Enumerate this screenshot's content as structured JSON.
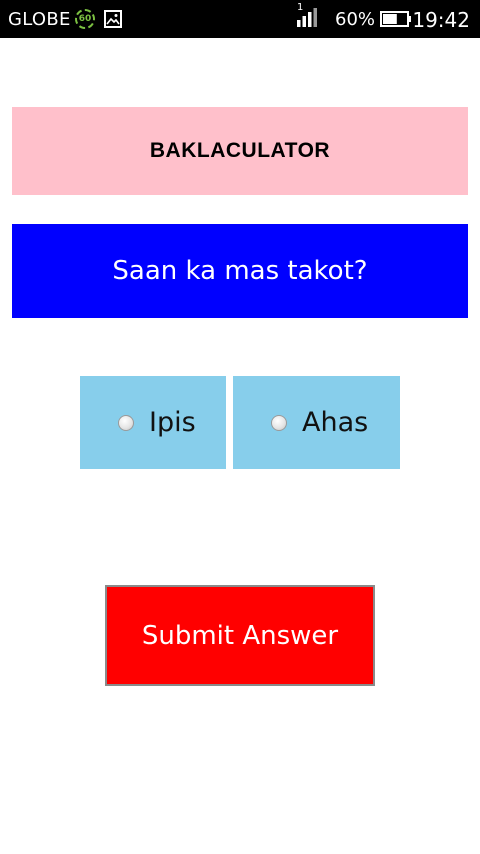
{
  "status_bar": {
    "carrier": "GLOBE",
    "data_badge": "60",
    "signal_slot": "1",
    "battery_percent": "60%",
    "battery_level": 0.6,
    "time": "19:42",
    "icons": [
      "data-indicator-icon",
      "image-icon",
      "signal-icon",
      "battery-icon"
    ]
  },
  "app": {
    "title": "BAKLACULATOR",
    "question": "Saan ka mas takot?",
    "options": [
      {
        "label": "Ipis",
        "selected": false
      },
      {
        "label": "Ahas",
        "selected": false
      }
    ],
    "submit_label": "Submit Answer"
  },
  "colors": {
    "title_bg": "#ffc0cb",
    "question_bg": "#0000ff",
    "option_bg": "#87ceeb",
    "submit_bg": "#ff0000",
    "status_bar_bg": "#000000"
  }
}
